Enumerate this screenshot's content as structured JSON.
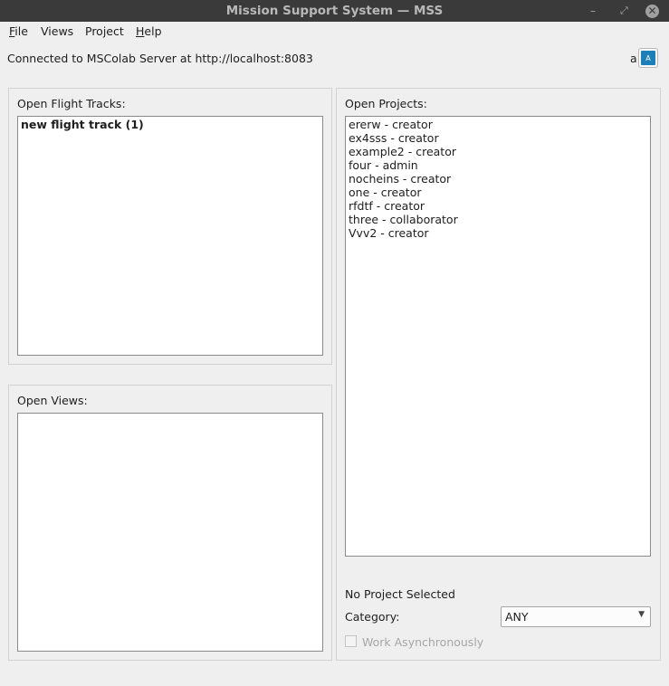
{
  "window": {
    "title": "Mission Support System — MSS",
    "controls": {
      "minimize": "–",
      "maximize": "⤢",
      "close": "✕"
    }
  },
  "menu": {
    "items": [
      "File",
      "Views",
      "Project",
      "Help"
    ]
  },
  "connection": {
    "status": "Connected to MSColab Server at http://localhost:8083"
  },
  "user": {
    "name": "a",
    "avatar_letter": "A",
    "avatar_color": "#1d7fb8"
  },
  "flight_tracks": {
    "label": "Open Flight Tracks:",
    "items": [
      "new flight track (1)"
    ]
  },
  "views": {
    "label": "Open Views:",
    "items": []
  },
  "projects": {
    "label": "Open Projects:",
    "items": [
      "ererw - creator",
      "ex4sss - creator",
      "example2 - creator",
      "four - admin",
      "nocheins - creator",
      "one - creator",
      "rfdtf - creator",
      "three - collaborator",
      "Vvv2 - creator"
    ]
  },
  "project_info": {
    "selection": "No Project Selected",
    "category_label": "Category:",
    "category_value": "ANY",
    "work_async_label": "Work Asynchronously"
  }
}
